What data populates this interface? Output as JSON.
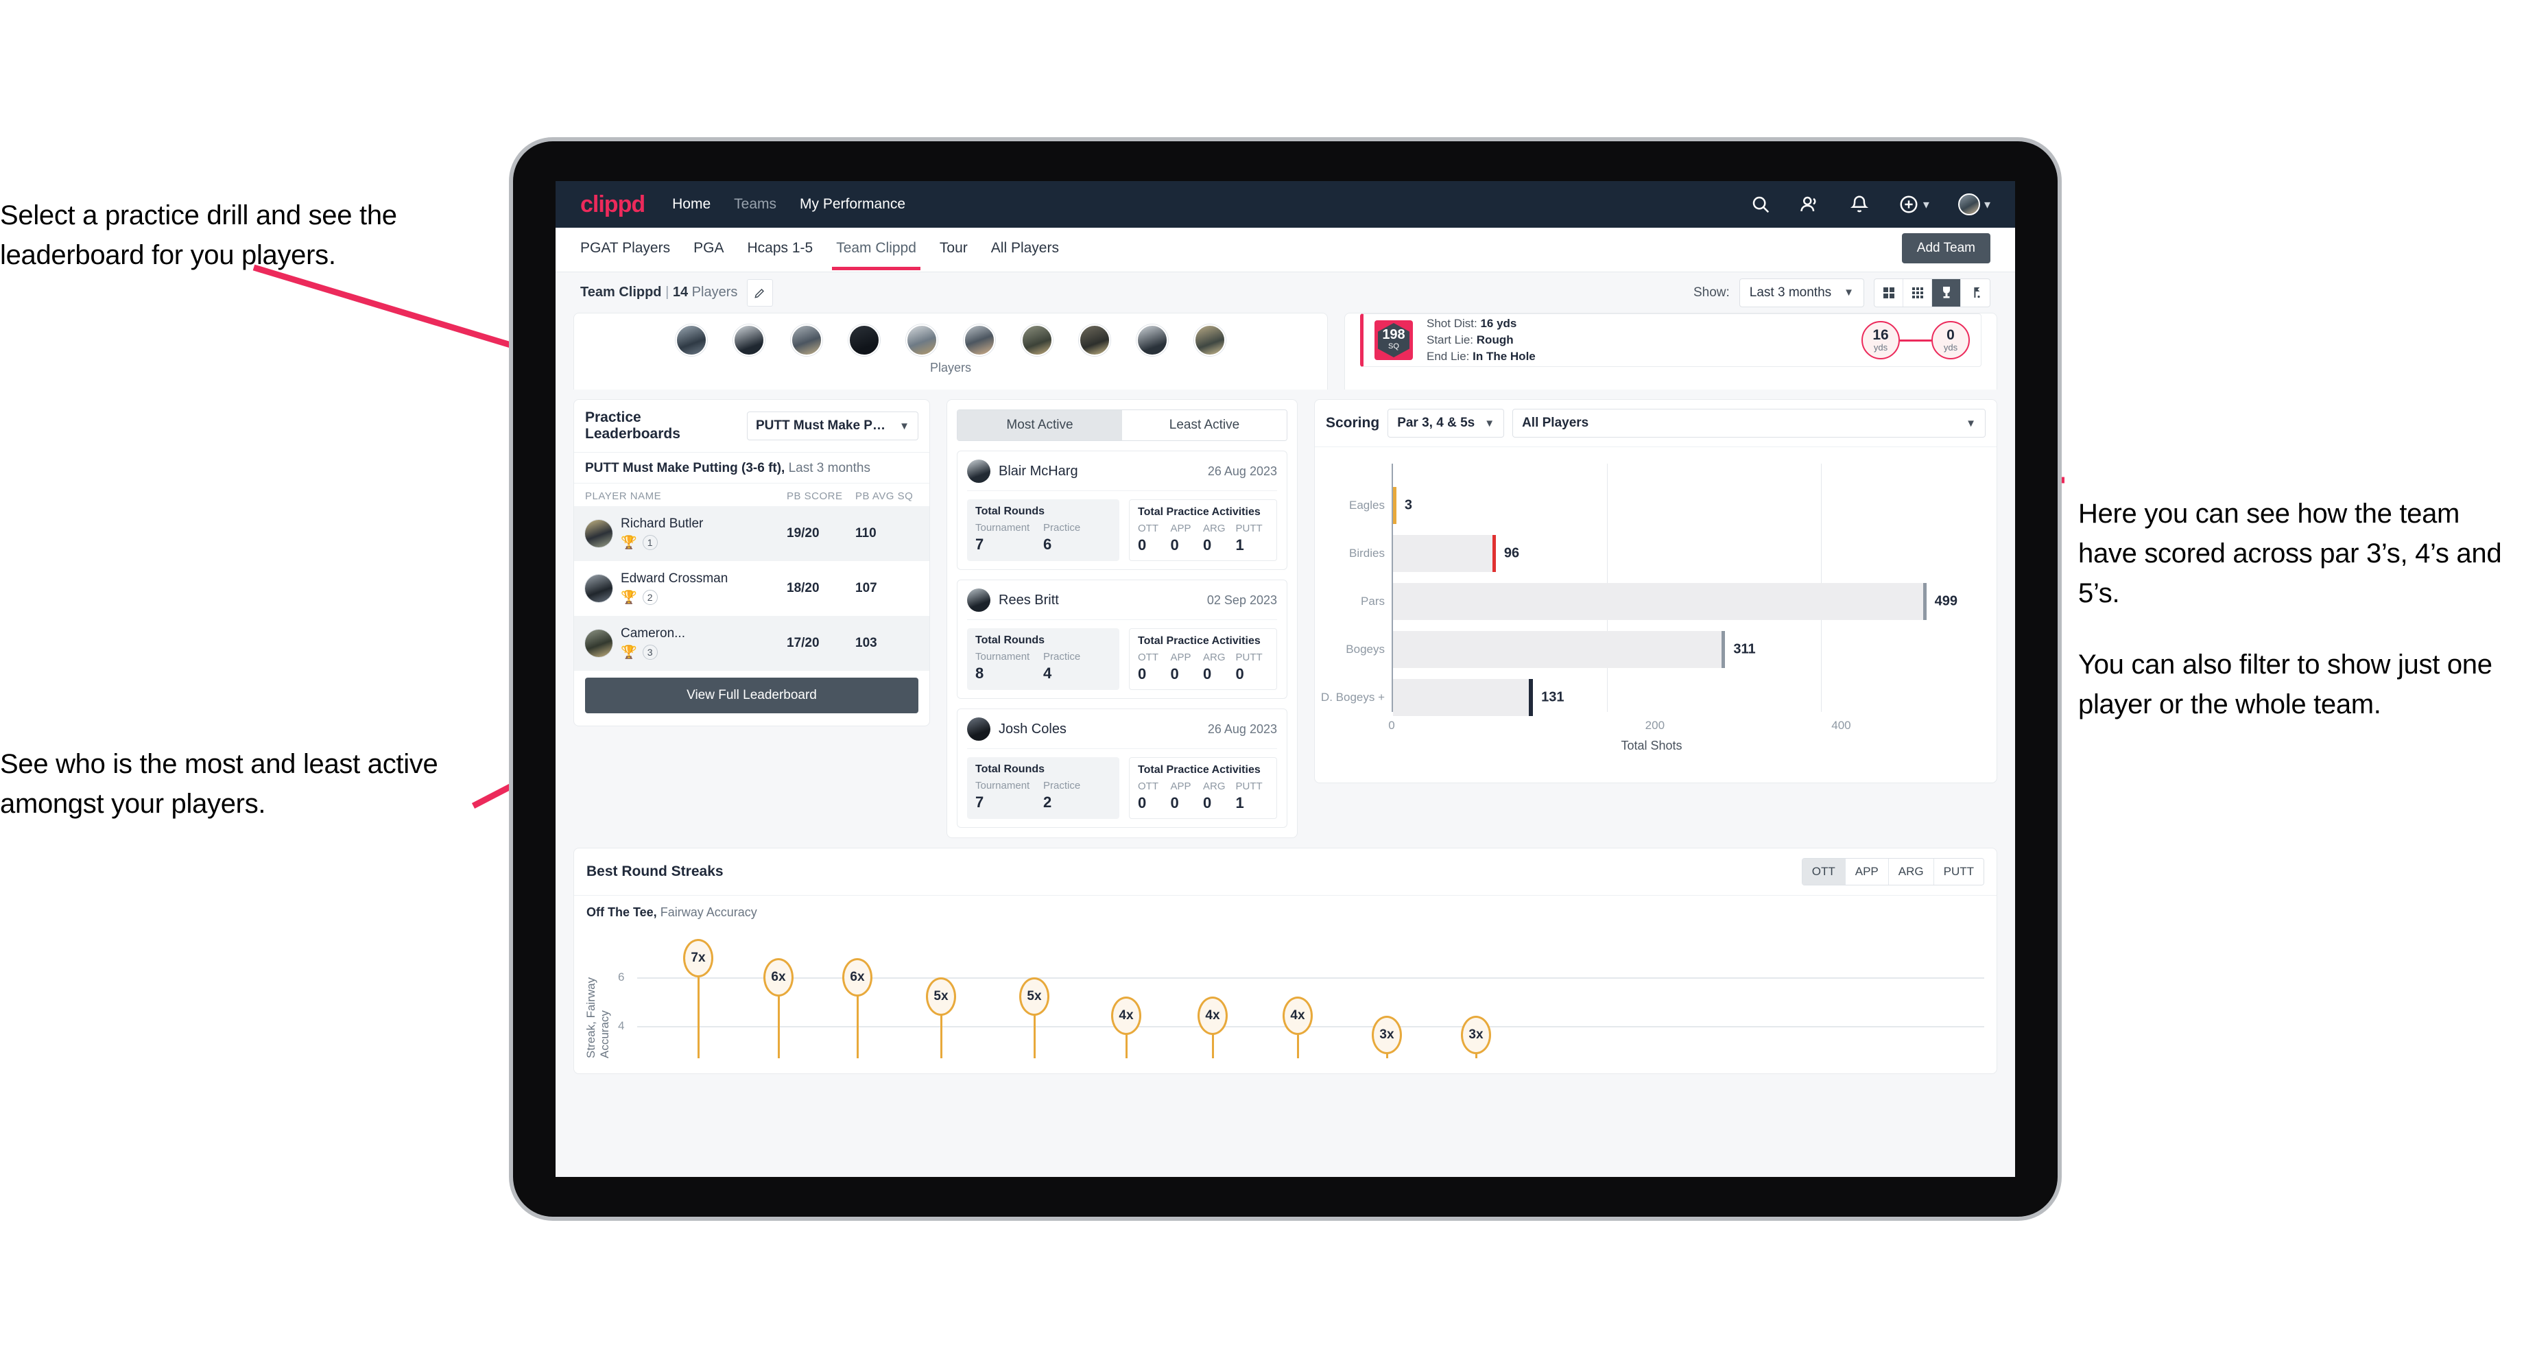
{
  "annotations": {
    "drill": "Select a practice drill and see the leaderboard for you players.",
    "active": "See who is the most and least active amongst your players.",
    "scoring_p1": "Here you can see how the team have scored across par 3’s, 4’s and 5’s.",
    "scoring_p2": "You can also filter to show just one player or the whole team."
  },
  "topnav": {
    "logo": "clippd",
    "links": [
      {
        "label": "Home",
        "active": true
      },
      {
        "label": "Teams",
        "active": false
      },
      {
        "label": "My Performance",
        "active": true
      }
    ],
    "icons": [
      "search-icon",
      "people-icon",
      "bell-icon",
      "plus-circle-icon"
    ]
  },
  "tabs": {
    "items": [
      {
        "label": "PGAT Players",
        "active": false
      },
      {
        "label": "PGA",
        "active": false
      },
      {
        "label": "Hcaps 1-5",
        "active": false
      },
      {
        "label": "Team Clippd",
        "active": true
      },
      {
        "label": "Tour",
        "active": false
      },
      {
        "label": "All Players",
        "active": false
      }
    ],
    "add_team": "Add Team"
  },
  "toolbar": {
    "team_name": "Team Clippd",
    "separator": "|",
    "player_count": "14",
    "players_word": "Players",
    "edit_icon": "pencil-icon",
    "show_label": "Show:",
    "range_value": "Last 3 months",
    "view_modes": [
      "grid-large-icon",
      "grid-small-icon",
      "trophy-icon",
      "flag-icon"
    ],
    "active_view": 2
  },
  "players_strip": {
    "caption": "Players",
    "avatar_count": 10
  },
  "shot_card": {
    "sq_value": "198",
    "sq_label": "SQ",
    "lines": [
      {
        "key": "Shot Dist:",
        "val": "16 yds"
      },
      {
        "key": "Start Lie:",
        "val": "Rough"
      },
      {
        "key": "End Lie:",
        "val": "In The Hole"
      }
    ],
    "start_yds": "16",
    "end_yds": "0",
    "yds_unit": "yds"
  },
  "leaderboard": {
    "title": "Practice Leaderboards",
    "drill_select": "PUTT Must Make Putting ...",
    "subtitle_bold": "PUTT Must Make Putting (3-6 ft),",
    "subtitle_rest": "Last 3 months",
    "columns": [
      "PLAYER NAME",
      "PB SCORE",
      "PB AVG SQ"
    ],
    "rows": [
      {
        "name": "Richard Butler",
        "rank": "1",
        "trophy": "gold",
        "score": "19/20",
        "sq": "110"
      },
      {
        "name": "Edward Crossman",
        "rank": "2",
        "trophy": "silver",
        "score": "18/20",
        "sq": "107"
      },
      {
        "name": "Cameron...",
        "rank": "3",
        "trophy": "bronze",
        "score": "17/20",
        "sq": "103"
      }
    ],
    "button": "View Full Leaderboard"
  },
  "activity": {
    "tabs": [
      {
        "label": "Most Active",
        "active": true
      },
      {
        "label": "Least Active",
        "active": false
      }
    ],
    "rounds_title": "Total Rounds",
    "rounds_keys": [
      "Tournament",
      "Practice"
    ],
    "practice_title": "Total Practice Activities",
    "practice_keys": [
      "OTT",
      "APP",
      "ARG",
      "PUTT"
    ],
    "items": [
      {
        "name": "Blair McHarg",
        "date": "26 Aug 2023",
        "rounds": [
          "7",
          "6"
        ],
        "practice": [
          "0",
          "0",
          "0",
          "1"
        ]
      },
      {
        "name": "Rees Britt",
        "date": "02 Sep 2023",
        "rounds": [
          "8",
          "4"
        ],
        "practice": [
          "0",
          "0",
          "0",
          "0"
        ]
      },
      {
        "name": "Josh Coles",
        "date": "26 Aug 2023",
        "rounds": [
          "7",
          "2"
        ],
        "practice": [
          "0",
          "0",
          "0",
          "1"
        ]
      }
    ]
  },
  "scoring": {
    "title": "Scoring",
    "par_filter": "Par 3, 4 & 5s",
    "player_filter": "All Players"
  },
  "streaks": {
    "title": "Best Round Streaks",
    "segments": [
      {
        "label": "OTT",
        "active": true
      },
      {
        "label": "APP",
        "active": false
      },
      {
        "label": "ARG",
        "active": false
      },
      {
        "label": "PUTT",
        "active": false
      }
    ],
    "sub_bold": "Off The Tee,",
    "sub_rest": "Fairway Accuracy"
  },
  "colors": {
    "brand_pink": "#ec2a5b",
    "nav_dark": "#1b2838",
    "slate": "#4a5560",
    "amber": "#e8a93b",
    "eagle_gold": "#e8a93b",
    "birdie_red": "#e03131"
  },
  "chart_data": [
    {
      "type": "bar",
      "title": "Scoring",
      "orientation": "horizontal",
      "categories": [
        "Eagles",
        "Birdies",
        "Pars",
        "Bogeys",
        "D. Bogeys +"
      ],
      "values": [
        3,
        96,
        499,
        311,
        131
      ],
      "cap_colors": [
        "#e8a93b",
        "#e03131",
        "#8e98a3",
        "#8e98a3",
        "#20293a"
      ],
      "xlabel": "Total Shots",
      "ylabel": "",
      "xticks": [
        0,
        200,
        400
      ],
      "xlim": [
        0,
        520
      ],
      "grid": true,
      "legend": "none",
      "value_labels": [
        "3",
        "96",
        "499",
        "311",
        "131"
      ]
    },
    {
      "type": "scatter",
      "title": "Off The Tee, Fairway Accuracy",
      "ylabel": "Streak, Fairway Accuracy",
      "xlabel": "",
      "yticks": [
        4,
        6
      ],
      "ylim": [
        0,
        8
      ],
      "grid": true,
      "labels": [
        "7x",
        "6x",
        "6x",
        "5x",
        "5x",
        "4x",
        "4x",
        "4x",
        "3x",
        "3x"
      ],
      "values": [
        7,
        6,
        6,
        5,
        5,
        4,
        4,
        4,
        3,
        3
      ],
      "x_index": [
        0,
        1,
        2,
        3,
        4,
        5,
        6,
        7,
        8,
        9
      ]
    }
  ]
}
